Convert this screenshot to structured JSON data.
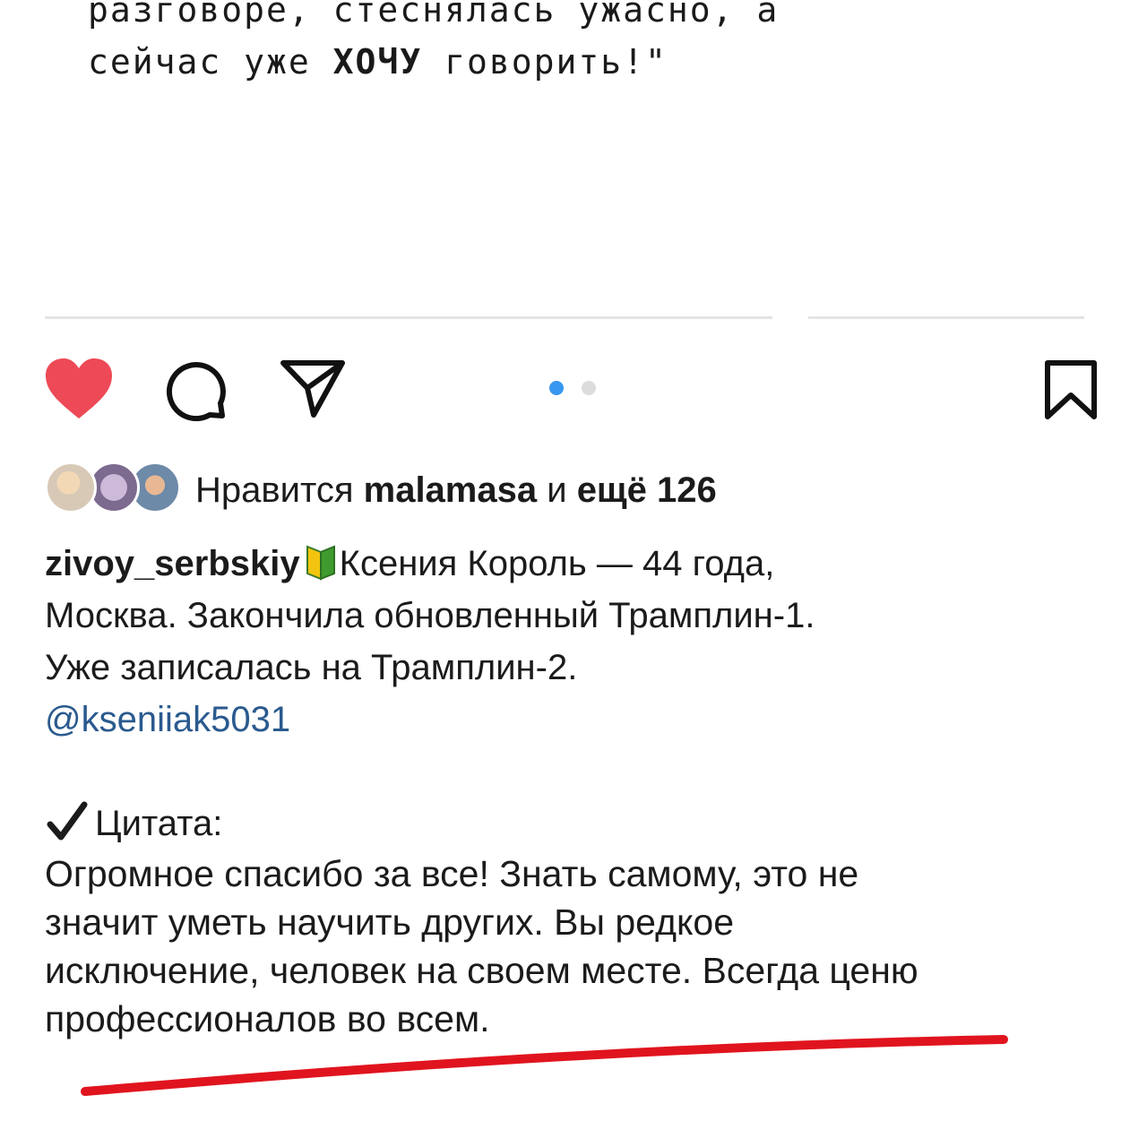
{
  "top_quote": {
    "line1": "разговоре, стеснялась ужасно, а",
    "line2_prefix": "сейчас уже ",
    "line2_bold": "ХОЧУ",
    "line2_suffix": " говорить!\""
  },
  "actions": {
    "like_icon": "heart-filled-icon",
    "comment_icon": "comment-icon",
    "share_icon": "send-icon",
    "save_icon": "bookmark-icon",
    "carousel_total": 2,
    "carousel_active": 1,
    "colors": {
      "like": "#ed4956",
      "dot_active": "#3897f0",
      "dot_inactive": "#dcdcdc"
    }
  },
  "likes": {
    "prefix": "Нравится ",
    "user": "malamasa",
    "middle": " и ",
    "more": "ещё 126"
  },
  "caption": {
    "username": "zivoy_serbskiy",
    "badge_icon": "beginner-badge-icon",
    "line1": "Ксения Король —  44 года,",
    "line2": "Москва. Закончила обновленный Трамплин-1.",
    "line3": "Уже записалась на Трамплин-2.",
    "mention": "@kseniiak5031",
    "quote_label": "Цитата:",
    "quote_lines": [
      "Огромное спасибо за все! Знать самому, это не",
      "значит уметь научить других. Вы редкое",
      "исключение, человек на своем месте. Всегда ценю",
      "профессионалов во всем."
    ],
    "mention_color": "#2a5a8e",
    "underline_color": "#e0141e"
  }
}
